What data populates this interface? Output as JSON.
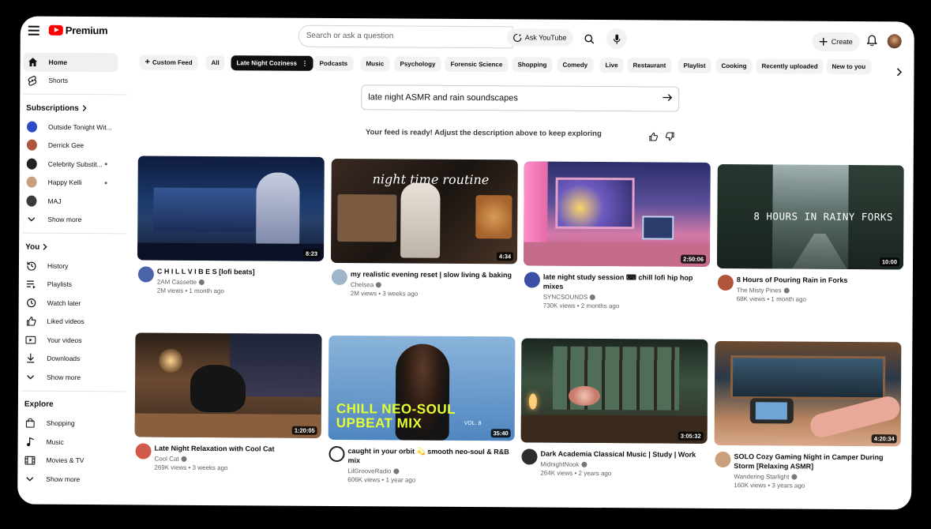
{
  "header": {
    "logo_text": "Premium",
    "search_placeholder": "Search or ask a question",
    "ask_label": "Ask YouTube",
    "create_label": "Create"
  },
  "sidebar": {
    "home": "Home",
    "shorts": "Shorts",
    "subscriptions_heading": "Subscriptions",
    "channels": [
      {
        "name": "Outside Tonight Wit...",
        "color": "#2b4cc6",
        "dot": false
      },
      {
        "name": "Derrick Gee",
        "color": "#b0553a",
        "dot": false
      },
      {
        "name": "Celebrity Substit...",
        "color": "#222222",
        "dot": true
      },
      {
        "name": "Happy Kelli",
        "color": "#c9a07b",
        "dot": true
      },
      {
        "name": "MAJ",
        "color": "#3a3a3a",
        "dot": false
      }
    ],
    "show_more_1": "Show more",
    "you_heading": "You",
    "you_items": [
      "History",
      "Playlists",
      "Watch later",
      "Liked videos",
      "Your videos",
      "Downloads"
    ],
    "show_more_2": "Show more",
    "explore_heading": "Explore",
    "explore_items": [
      "Shopping",
      "Music",
      "Movies & TV"
    ],
    "show_more_3": "Show more"
  },
  "chips": [
    "Custom Feed",
    "All",
    "Late Night Coziness",
    "Podcasts",
    "Music",
    "Psychology",
    "Forensic Science",
    "Shopping",
    "Comedy",
    "Live",
    "Restaurant",
    "Playlist",
    "Cooking",
    "Recently uploaded",
    "New to you"
  ],
  "selected_chip": "Late Night Coziness",
  "prompt": {
    "text": "late night ASMR and rain soundscapes",
    "ready_message": "Your feed is ready! Adjust the description above to keep exploring"
  },
  "videos": [
    {
      "title": "C H I L L  V I B E S [lofi beats]",
      "channel": "2AM Cassette",
      "stats": "2M views • 1 month ago",
      "duration": "8:23"
    },
    {
      "title": "my realistic evening reset | slow living & baking",
      "channel": "Chelsea",
      "stats": "2M views • 3 weeks ago",
      "duration": "4:34",
      "overlay": "night time routine"
    },
    {
      "title": "late night study session ⌨ chill lofi hip hop mixes",
      "channel": "SYNCSOUNDS",
      "stats": "730K views • 2 months ago",
      "duration": "2:50:06"
    },
    {
      "title": "8 Hours of Pouring Rain in Forks",
      "channel": "The Misty Pines",
      "stats": "68K views • 1 month ago",
      "duration": "10:00",
      "overlay": "8 HOURS IN RAINY FORKS"
    },
    {
      "title": "Late Night Relaxation with Cool Cat",
      "channel": "Cool Cat",
      "stats": "269K views • 3 weeks ago",
      "duration": "1:20:05"
    },
    {
      "title": "caught in your orbit 💫 smooth neo-soul & R&B mix",
      "channel": "LilGrooveRadio",
      "stats": "606K views • 1 year ago",
      "duration": "35:40",
      "overlay": "CHILL NEO-SOUL UPBEAT MIX",
      "overlay_small": "VOL. 8"
    },
    {
      "title": "Dark Academia Classical Music | Study | Work",
      "channel": "MidnightNook",
      "stats": "264K views • 2 years ago",
      "duration": "3:05:32"
    },
    {
      "title": "SOLO Cozy Gaming Night in Camper During Storm [Relaxing ASMR]",
      "channel": "Wandering Starlight",
      "stats": "160K views • 3 years ago",
      "duration": "4:20:34"
    }
  ],
  "colors": {
    "brand_red": "#ff0000",
    "selected_chip_bg": "#0f0f0f",
    "chip_bg": "#f2f2f2"
  }
}
